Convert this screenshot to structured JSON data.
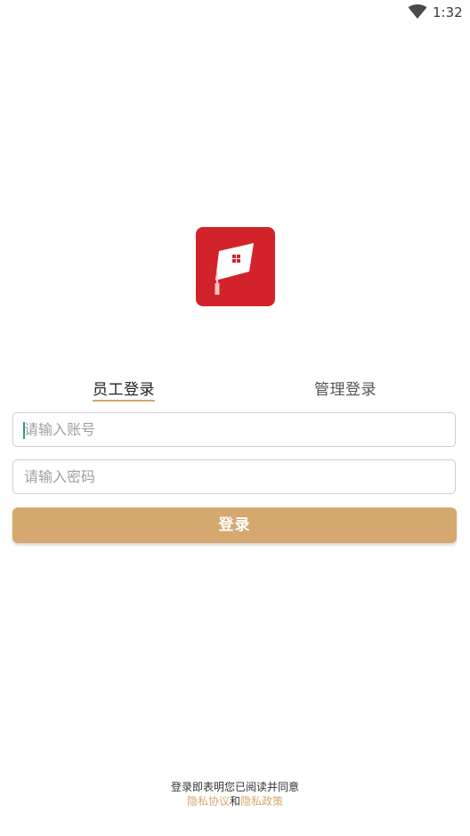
{
  "status_bar": {
    "time": "1:32",
    "wifi_icon": "wifi-icon"
  },
  "logo": {
    "icon": "graduation-cap-icon",
    "color": "#d2232a"
  },
  "tabs": {
    "staff_label": "员工登录",
    "admin_label": "管理登录",
    "active": "staff",
    "accent_color": "#d4a86f"
  },
  "form": {
    "account_placeholder": "请输入账号",
    "account_value": "",
    "password_placeholder": "请输入密码",
    "password_value": "",
    "submit_label": "登录",
    "button_color": "#d4a86f"
  },
  "footer": {
    "agreement_text": "登录即表明您已阅读并同意",
    "privacy_agreement": "隐私协议",
    "and_text": "和",
    "privacy_policy": "隐私政策"
  }
}
